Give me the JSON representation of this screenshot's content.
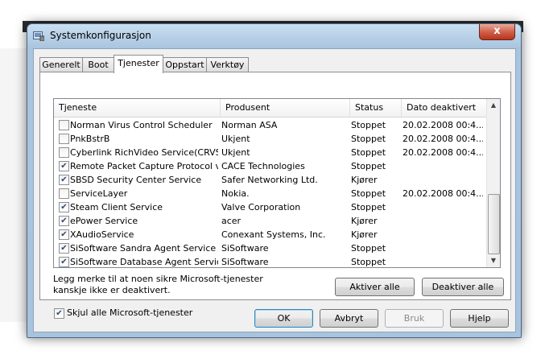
{
  "window": {
    "title": "Systemkonfigurasjon",
    "close_glyph": "x"
  },
  "tabs": [
    {
      "label": "Generelt",
      "active": false
    },
    {
      "label": "Boot",
      "active": false
    },
    {
      "label": "Tjenester",
      "active": true
    },
    {
      "label": "Oppstart",
      "active": false
    },
    {
      "label": "Verktøy",
      "active": false
    }
  ],
  "table": {
    "columns": [
      "Tjeneste",
      "Produsent",
      "Status",
      "Dato deaktivert"
    ],
    "rows": [
      {
        "checked": false,
        "service": "Norman Virus Control Scheduler",
        "manufacturer": "Norman ASA",
        "status": "Stoppet",
        "date": "20.02.2008 00:4..."
      },
      {
        "checked": false,
        "service": "PnkBstrB",
        "manufacturer": "Ukjent",
        "status": "Stoppet",
        "date": "20.02.2008 00:4..."
      },
      {
        "checked": false,
        "service": "Cyberlink RichVideo Service(CRVS)",
        "manufacturer": "Ukjent",
        "status": "Stoppet",
        "date": "20.02.2008 00:4..."
      },
      {
        "checked": true,
        "service": "Remote Packet Capture Protocol v...",
        "manufacturer": "CACE Technologies",
        "status": "Stoppet",
        "date": ""
      },
      {
        "checked": true,
        "service": "SBSD Security Center Service",
        "manufacturer": "Safer Networking Ltd.",
        "status": "Kjører",
        "date": ""
      },
      {
        "checked": false,
        "service": "ServiceLayer",
        "manufacturer": "Nokia.",
        "status": "Stoppet",
        "date": "20.02.2008 00:4..."
      },
      {
        "checked": true,
        "service": "Steam Client Service",
        "manufacturer": "Valve Corporation",
        "status": "Stoppet",
        "date": ""
      },
      {
        "checked": true,
        "service": "ePower Service",
        "manufacturer": "acer",
        "status": "Kjører",
        "date": ""
      },
      {
        "checked": true,
        "service": "XAudioService",
        "manufacturer": "Conexant Systems, Inc.",
        "status": "Kjører",
        "date": ""
      },
      {
        "checked": true,
        "service": "SiSoftware Sandra Agent Service",
        "manufacturer": "SiSoftware",
        "status": "Stoppet",
        "date": ""
      },
      {
        "checked": true,
        "service": "SiSoftware Database Agent Service",
        "manufacturer": "SiSoftware",
        "status": "Stoppet",
        "date": ""
      }
    ]
  },
  "note": "Legg merke til at noen sikre Microsoft-tjenester kanskje ikke er deaktivert.",
  "buttons": {
    "enable_all": "Aktiver alle",
    "disable_all": "Deaktiver alle",
    "ok": "OK",
    "cancel": "Avbryt",
    "apply": "Bruk",
    "help": "Hjelp"
  },
  "hide_ms": {
    "label": "Skjul alle Microsoft-tjenester",
    "checked": true
  }
}
